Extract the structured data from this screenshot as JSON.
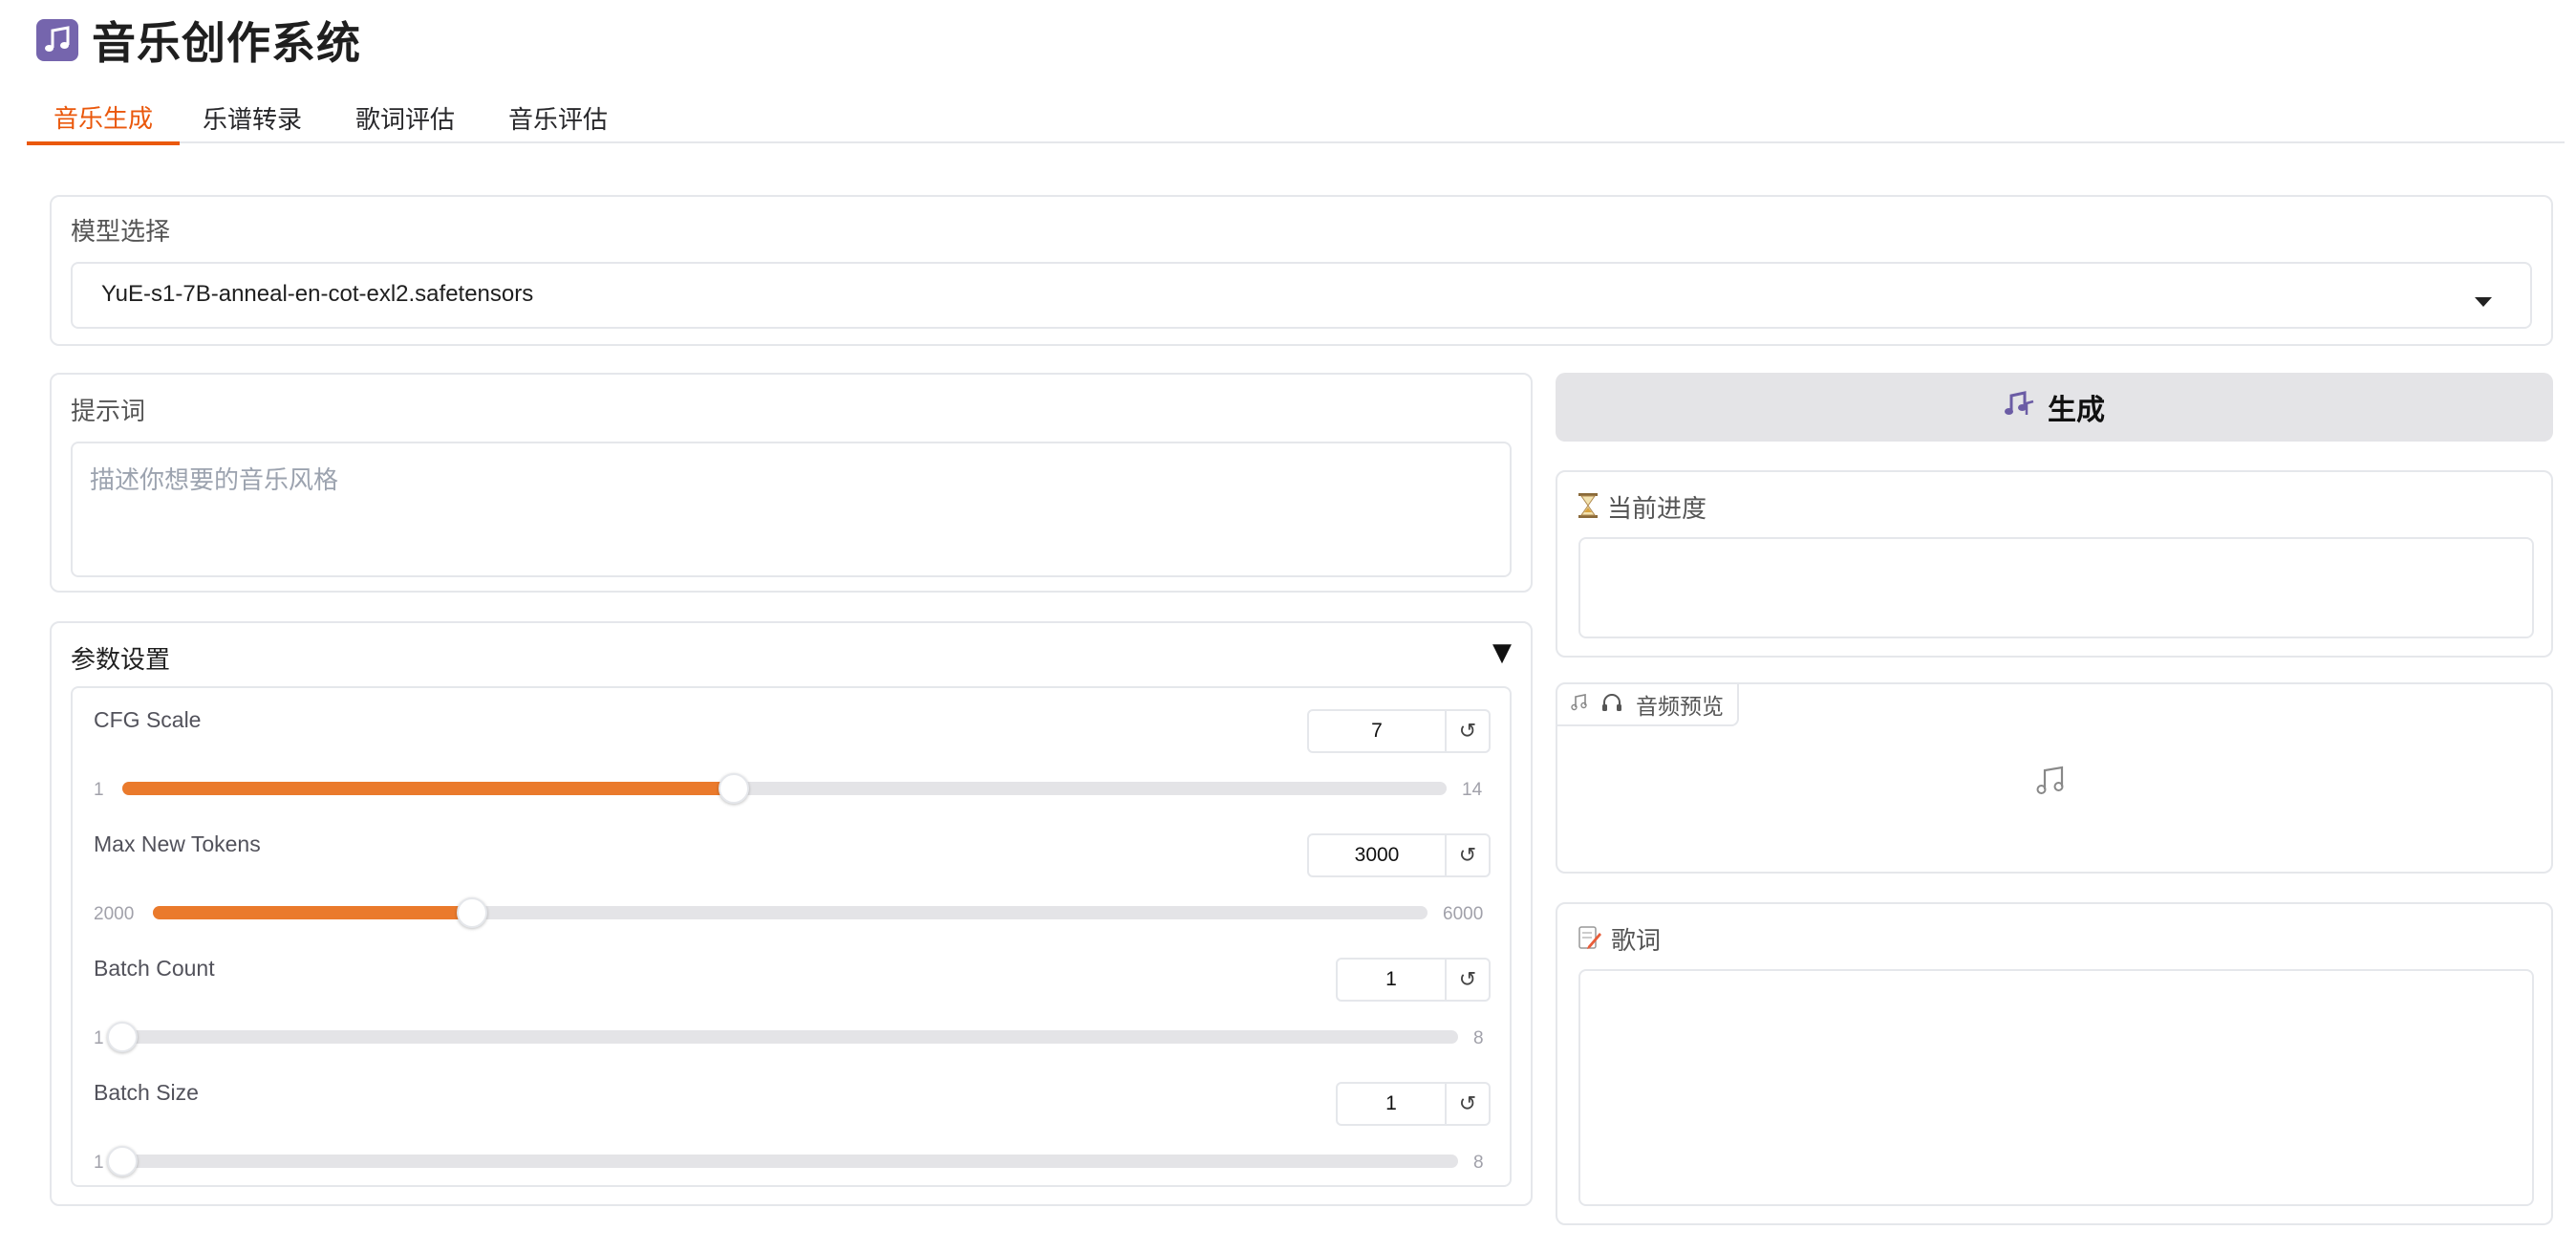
{
  "app": {
    "title": "音乐创作系统",
    "icon": "music-note-icon"
  },
  "tabs": [
    {
      "label": "音乐生成",
      "active": true
    },
    {
      "label": "乐谱转录",
      "active": false
    },
    {
      "label": "歌词评估",
      "active": false
    },
    {
      "label": "音乐评估",
      "active": false
    }
  ],
  "model": {
    "label": "模型选择",
    "selected": "YuE-s1-7B-anneal-en-cot-exl2.safetensors"
  },
  "prompt": {
    "label": "提示词",
    "placeholder": "描述你想要的音乐风格",
    "value": ""
  },
  "params": {
    "label": "参数设置",
    "collapse_icon": "▼",
    "cfg": {
      "label": "CFG Scale",
      "value": "7",
      "min": "1",
      "max": "14",
      "fraction": 0.4615
    },
    "max_tokens": {
      "label": "Max New Tokens",
      "value": "3000",
      "min": "2000",
      "max": "6000",
      "fraction": 0.25
    },
    "batch_count": {
      "label": "Batch Count",
      "value": "1",
      "min": "1",
      "max": "8",
      "fraction": 0
    },
    "batch_size": {
      "label": "Batch Size",
      "value": "1",
      "min": "1",
      "max": "8",
      "fraction": 0
    },
    "reset_icon": "↺"
  },
  "generate": {
    "label": "生成",
    "icon": "music-notes-icon"
  },
  "progress": {
    "label": "当前进度",
    "icon": "hourglass-icon",
    "value": ""
  },
  "audio": {
    "label": "音频预览",
    "icon": "headphones-icon",
    "empty_icon": "music-note-icon"
  },
  "lyrics": {
    "label": "歌词",
    "icon": "memo-icon",
    "value": ""
  },
  "colors": {
    "accent": "#ea580c",
    "slider_fill": "#ea7a2c",
    "icon_purple": "#6b5ca5"
  }
}
